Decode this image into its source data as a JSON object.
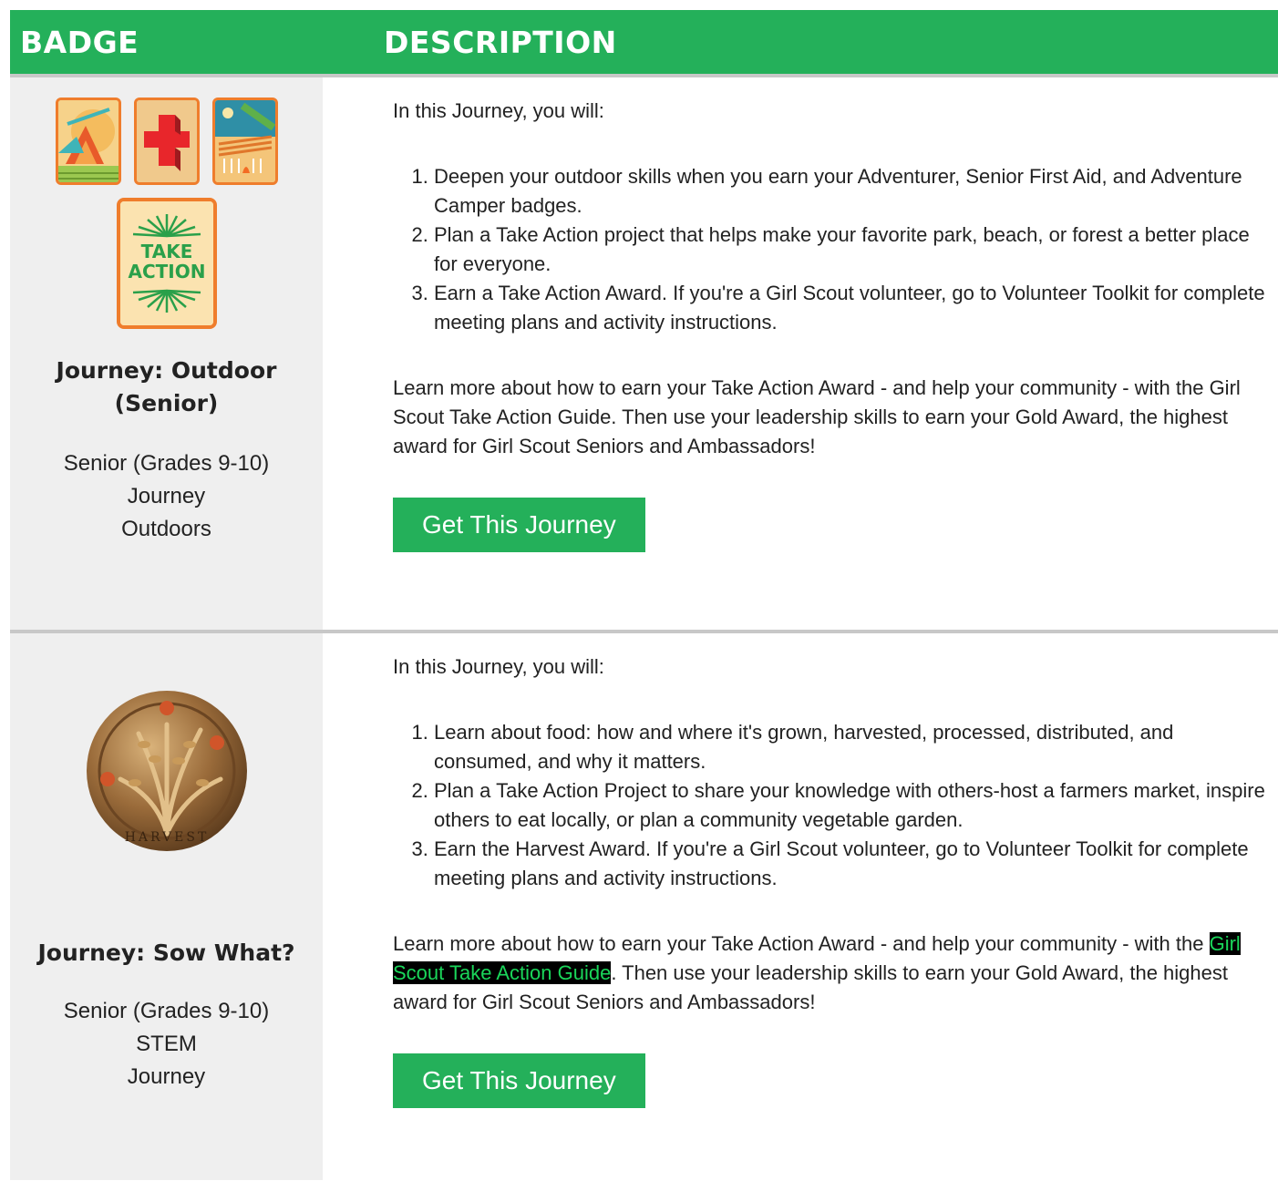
{
  "header": {
    "badge": "BADGE",
    "description": "DESCRIPTION"
  },
  "rows": [
    {
      "title": "Journey: Outdoor (Senior)",
      "meta": [
        "Senior (Grades 9-10)",
        "Journey",
        "Outdoors"
      ],
      "intro": "In this Journey, you will:",
      "steps": [
        "Deepen your outdoor skills when you earn your Adventurer, Senior First Aid, and Adventure Camper badges.",
        "Plan a Take Action project that helps make your favorite park, beach, or forest a better place for everyone.",
        "Earn a Take Action Award. If you're a Girl Scout volunteer, go to Volunteer Toolkit for complete meeting plans and activity instructions."
      ],
      "learn_before": "Learn more about how to earn your Take Action Award - and help your community - with the Girl Scout Take Action Guide. Then use your leadership skills to earn your Gold Award, the highest award for Girl Scout Seniors and Ambassadors!",
      "button": "Get This Journey",
      "take_action_patch": [
        "TAKE",
        "ACTION"
      ]
    },
    {
      "title": "Journey: Sow What?",
      "meta": [
        "Senior (Grades 9-10)",
        "STEM",
        "Journey"
      ],
      "intro": "In this Journey, you will:",
      "steps": [
        "Learn about food: how and where it's grown, harvested, processed, distributed, and consumed, and why it matters.",
        "Plan a Take Action Project to share your knowledge with others-host a farmers market, inspire others to eat locally, or plan a community vegetable garden.",
        "Earn the Harvest Award. If you're a Girl Scout volunteer, go to Volunteer Toolkit for complete meeting plans and activity instructions."
      ],
      "learn_before": "Learn more about how to earn your Take Action Award - and help your community - with the ",
      "learn_link": "Girl Scout Take Action Guide",
      "learn_after": ". Then use your leadership skills to earn your Gold Award, the highest award for Girl Scout Seniors and Ambassadors!",
      "button": "Get This Journey",
      "pin_text": "HARVEST"
    }
  ]
}
